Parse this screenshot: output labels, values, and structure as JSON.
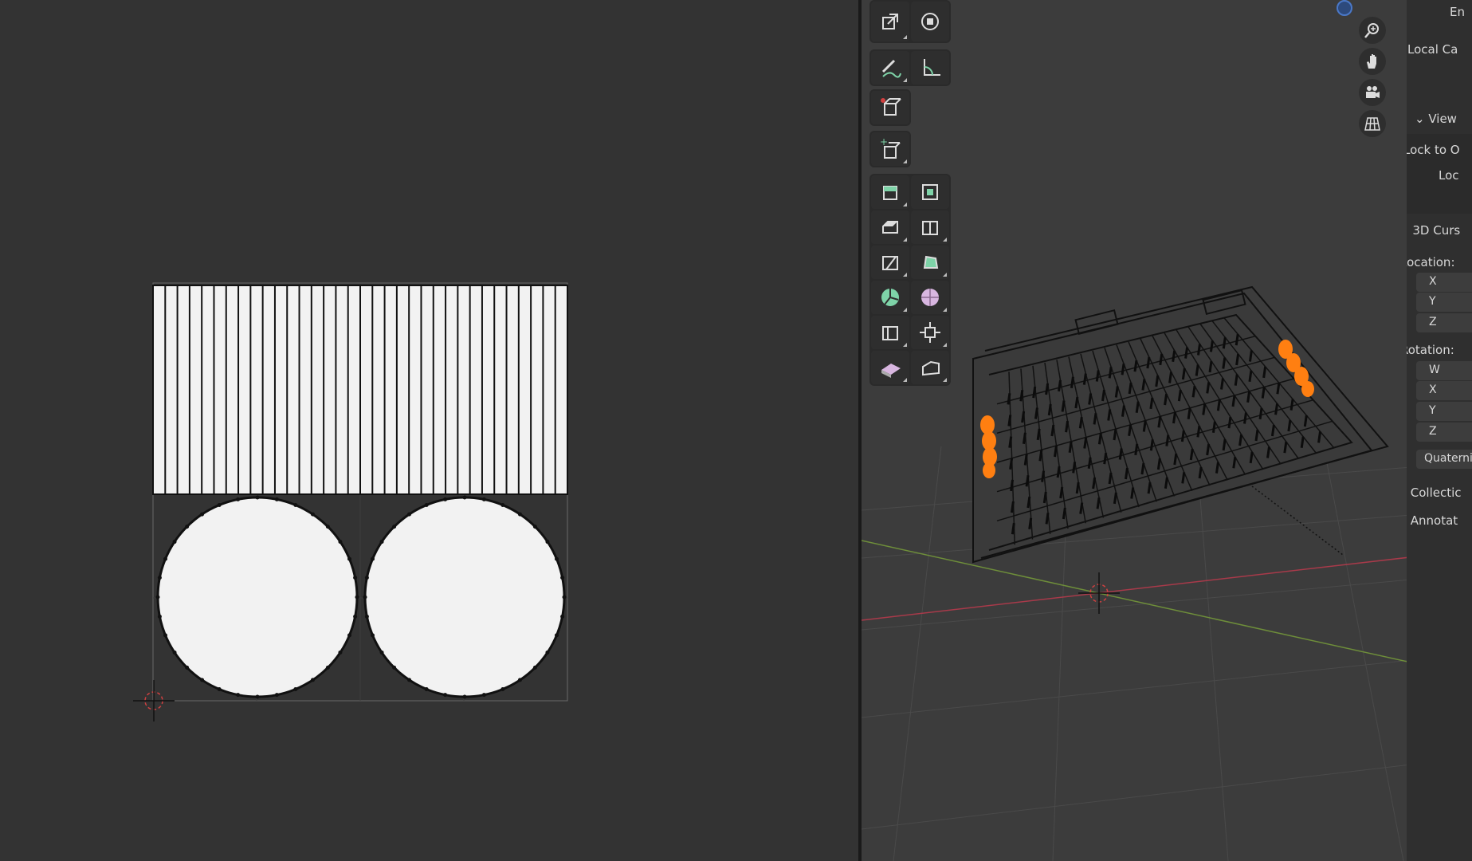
{
  "n_panel": {
    "top_partial": "En",
    "local_camera": "Local Ca",
    "view_header": "View",
    "lock_to_object": "Lock to O",
    "lock_partial": "Loc",
    "cursor_header": "3D Curs",
    "location_label": "Location:",
    "location_axes": [
      "X",
      "Y",
      "Z"
    ],
    "rotation_label": "Rotation:",
    "rotation_axes": [
      "W",
      "X",
      "Y",
      "Z"
    ],
    "rotation_mode": "Quaternic",
    "collections_header": "Collectic",
    "annotations_header": "Annotat"
  },
  "toolbar": {
    "tools": [
      "scale-icon",
      "transform-icon",
      "annotate-icon",
      "measure-icon",
      "add-cube-icon",
      "add-cube-alt-icon",
      "extrude-region-icon",
      "inset-faces-icon",
      "bevel-icon",
      "loop-cut-icon",
      "knife-icon",
      "poly-build-icon",
      "spin-icon",
      "smooth-icon",
      "edge-slide-icon",
      "shrink-fatten-icon",
      "shear-icon",
      "rip-region-icon"
    ]
  },
  "nav_gizmo": [
    "zoom-icon",
    "hand-icon",
    "camera-icon",
    "grid-icon"
  ],
  "colors": {
    "selection": "#ff7f11",
    "x_axis": "#a83a4a",
    "y_axis": "#6e8e3a",
    "uv_fill": "#f2f2f2"
  }
}
